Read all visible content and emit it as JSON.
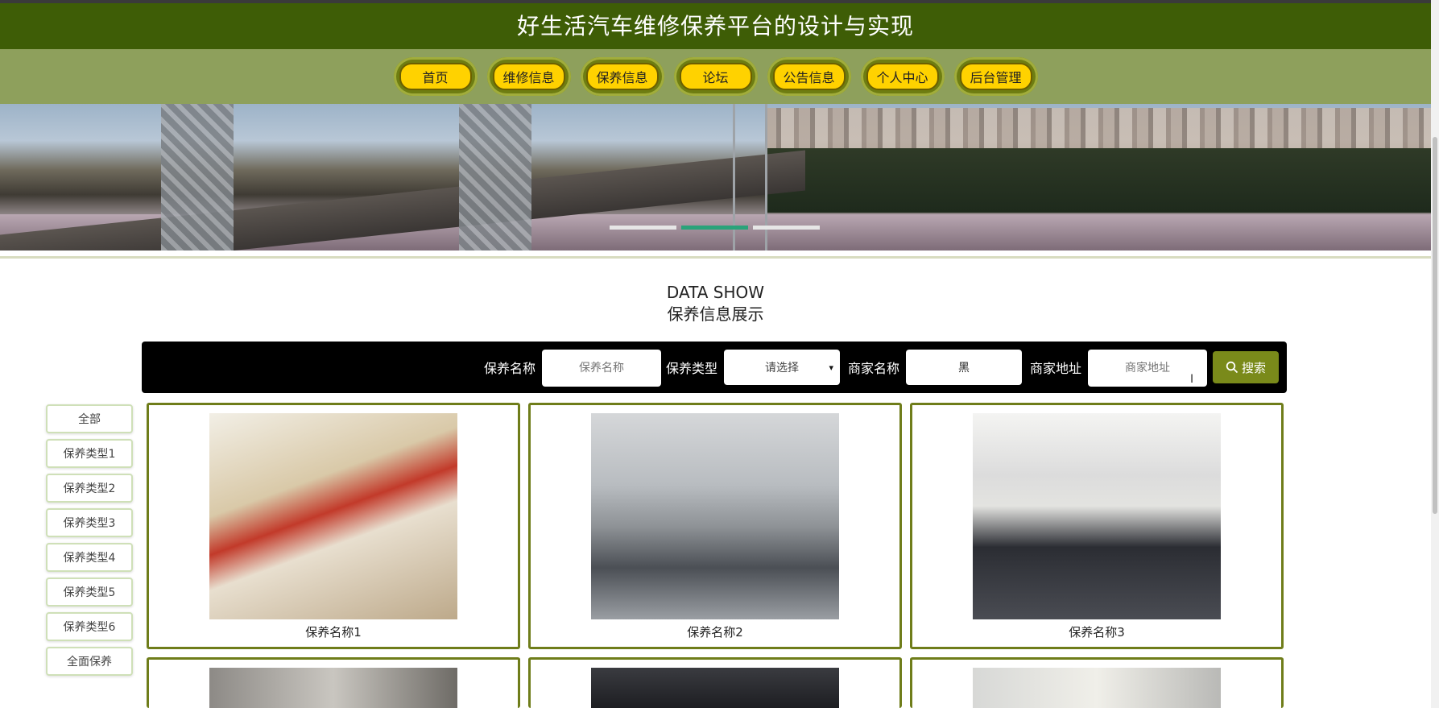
{
  "header": {
    "title": "好生活汽车维修保养平台的设计与实现"
  },
  "nav": [
    {
      "label": "首页"
    },
    {
      "label": "维修信息"
    },
    {
      "label": "保养信息"
    },
    {
      "label": "论坛"
    },
    {
      "label": "公告信息"
    },
    {
      "label": "个人中心"
    },
    {
      "label": "后台管理"
    }
  ],
  "banner": {
    "active_slide": 2,
    "slide_count": 3
  },
  "section": {
    "title_en": "DATA SHOW",
    "title_cn": "保养信息展示"
  },
  "search": {
    "name_label": "保养名称",
    "name_placeholder": "保养名称",
    "type_label": "保养类型",
    "type_selected": "请选择",
    "merchant_label": "商家名称",
    "merchant_value": "黑",
    "address_label": "商家地址",
    "address_placeholder": "商家地址",
    "button_label": "搜索"
  },
  "categories": [
    {
      "label": "全部"
    },
    {
      "label": "保养类型1"
    },
    {
      "label": "保养类型2"
    },
    {
      "label": "保养类型3"
    },
    {
      "label": "保养类型4"
    },
    {
      "label": "保养类型5"
    },
    {
      "label": "保养类型6"
    },
    {
      "label": "全面保养"
    }
  ],
  "items": [
    {
      "name": "保养名称1"
    },
    {
      "name": "保养名称2"
    },
    {
      "name": "保养名称3"
    }
  ],
  "colors": {
    "title_bg": "#3e5d06",
    "nav_bg": "#8ea05c",
    "pill": "#ffd200",
    "accent": "#7a8a1a",
    "dot_active": "#2aa37a"
  }
}
